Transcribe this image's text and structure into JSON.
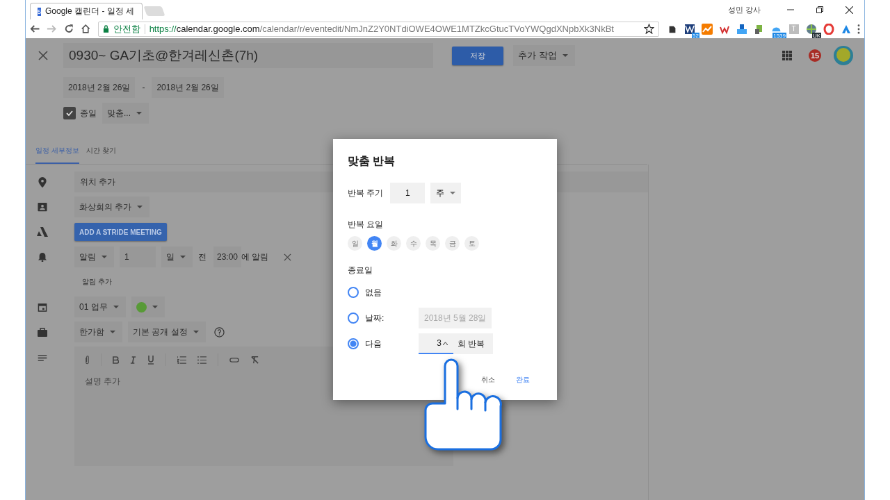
{
  "browser": {
    "tab_title": "Google 캘린더 - 일정 세",
    "tab_favicon": "5",
    "user_name": "성민 강사",
    "security": "안전함",
    "url_scheme": "https://",
    "url_host": "calendar.google.com",
    "url_path": "/calendar/r/eventedit/NmJnZ2Y0NTdiOWE4OWE1MTZkcGtucTVoYWQgdXNpbXk3NkBt",
    "extension_badges": [
      "52",
      "1539",
      "UK"
    ],
    "extension_letter": "T"
  },
  "event": {
    "title": "0930~ GA기초@한겨레신촌(7h)",
    "save": "저장",
    "more_actions": "추가 작업",
    "notifications_count": "15",
    "start_date": "2018년 2월 26일",
    "date_separator": "-",
    "end_date": "2018년 2월 26일",
    "all_day": {
      "label": "종일",
      "checked": true
    },
    "repeat": "맞춤..."
  },
  "tabs": [
    {
      "label": "일정 세부정보",
      "selected": true
    },
    {
      "label": "시간 찾기",
      "selected": false
    }
  ],
  "details": {
    "location_placeholder": "위치 추가",
    "conference": "화상회의 추가",
    "stride_button": "ADD A STRIDE MEETING",
    "notification": {
      "type": "알림",
      "amount": "1",
      "unit": "일",
      "before": "전",
      "time": "23:00",
      "suffix": "에 알림"
    },
    "add_notification": "알림 추가",
    "calendar": {
      "name": "01 업무",
      "color": "#589a37"
    },
    "availability": "한가함",
    "visibility": "기본 공개 설정",
    "description_placeholder": "설명 추가"
  },
  "dialog": {
    "title": "맞춤 반복",
    "interval_label": "반복 주기",
    "interval": "1",
    "interval_unit": "주",
    "days_label": "반복 요일",
    "days": [
      {
        "label": "일",
        "selected": false
      },
      {
        "label": "월",
        "selected": true
      },
      {
        "label": "화",
        "selected": false
      },
      {
        "label": "수",
        "selected": false
      },
      {
        "label": "목",
        "selected": false
      },
      {
        "label": "금",
        "selected": false
      },
      {
        "label": "토",
        "selected": false
      }
    ],
    "ends_label": "종료일",
    "ends": [
      {
        "kind": "never",
        "label": "없음",
        "selected": false
      },
      {
        "kind": "date",
        "label": "날짜:",
        "selected": false,
        "date": "2018년 5월 28일"
      },
      {
        "kind": "count",
        "label": "다음",
        "selected": true,
        "count": "3",
        "suffix": "회 반복"
      }
    ],
    "cancel": "취소",
    "done": "완료"
  }
}
